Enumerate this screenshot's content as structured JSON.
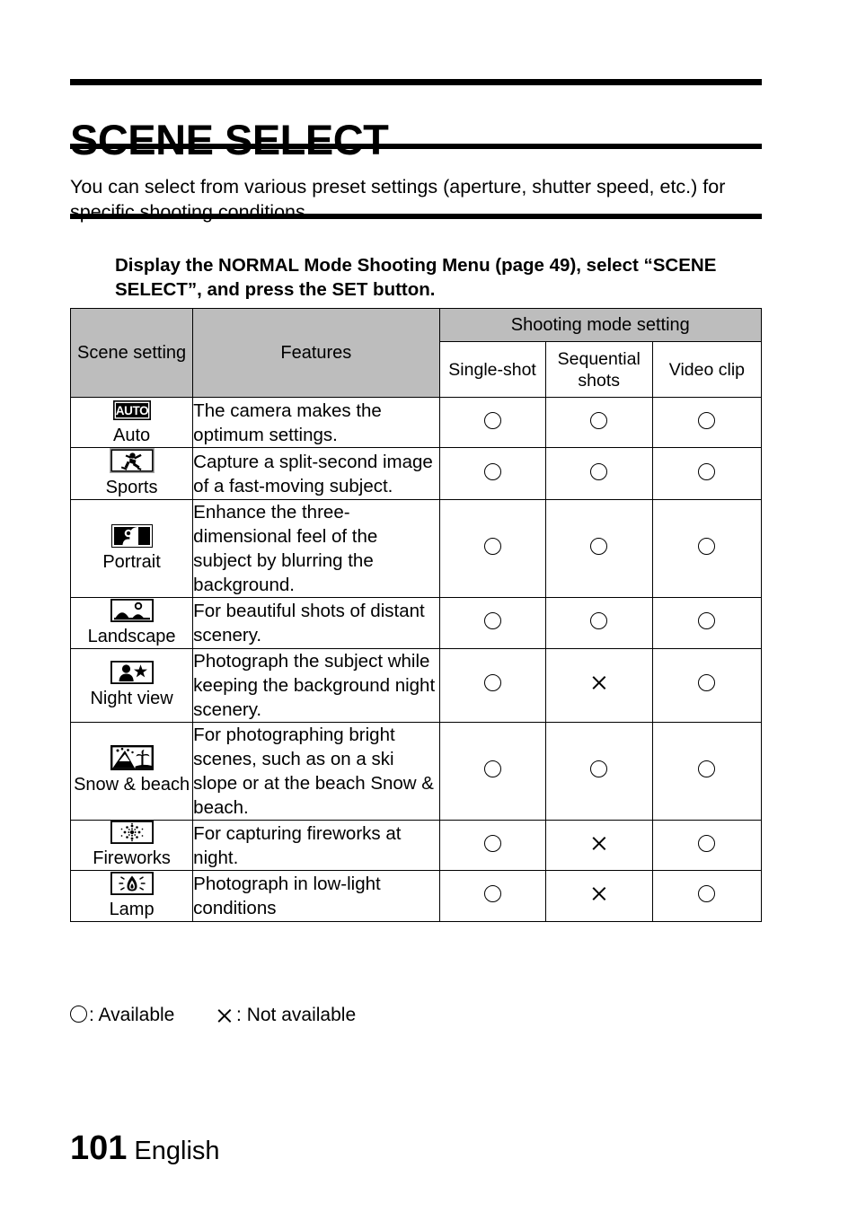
{
  "header": {
    "title": "SCENE SELECT",
    "intro": "You can select from various preset settings (aperture, shutter speed, etc.) for specific shooting conditions.",
    "instruction": "Display the NORMAL Mode Shooting Menu (page 49), select “SCENE SELECT”, and press the SET button."
  },
  "table": {
    "columns": {
      "scene_setting": "Scene setting",
      "features": "Features",
      "shooting_mode_setting": "Shooting mode setting",
      "single_shot": "Single-shot",
      "sequential_shots": "Sequential shots",
      "video_clip": "Video clip"
    },
    "rows": [
      {
        "icon": "auto-icon",
        "scene": "Auto",
        "features": "The camera makes the optimum settings.",
        "single_shot": "available",
        "sequential_shots": "available",
        "video_clip": "available"
      },
      {
        "icon": "sports-running-icon",
        "scene": "Sports",
        "features": "Capture a split-second image of a fast-moving subject.",
        "single_shot": "available",
        "sequential_shots": "available",
        "video_clip": "available"
      },
      {
        "icon": "portrait-icon",
        "scene": "Portrait",
        "features": "Enhance the three-dimensional feel of the subject by blurring the background.",
        "single_shot": "available",
        "sequential_shots": "available",
        "video_clip": "available"
      },
      {
        "icon": "landscape-mountain-icon",
        "scene": "Landscape",
        "features": "For beautiful shots of distant scenery.",
        "single_shot": "available",
        "sequential_shots": "available",
        "video_clip": "available"
      },
      {
        "icon": "night-view-person-star-icon",
        "scene": "Night view",
        "features": "Photograph the subject while keeping the background night scenery.",
        "single_shot": "available",
        "sequential_shots": "not-available",
        "video_clip": "available"
      },
      {
        "icon": "snow-beach-icon",
        "scene": "Snow & beach",
        "features": "For photographing bright scenes, such as on a ski slope or at the beach Snow & beach.",
        "single_shot": "available",
        "sequential_shots": "available",
        "video_clip": "available"
      },
      {
        "icon": "fireworks-burst-icon",
        "scene": "Fireworks",
        "features": "For capturing fireworks at night.",
        "single_shot": "available",
        "sequential_shots": "not-available",
        "video_clip": "available"
      },
      {
        "icon": "lamp-icon",
        "scene": "Lamp",
        "features": "Photograph in low-light conditions",
        "single_shot": "available",
        "sequential_shots": "not-available",
        "video_clip": "available"
      }
    ]
  },
  "legend": {
    "available": ": Available",
    "not_available": ": Not available"
  },
  "footer": {
    "page_number": "101",
    "language": "English"
  },
  "colors": {
    "header_fill": "#bdbdbd",
    "text": "#000000",
    "background": "#ffffff"
  }
}
